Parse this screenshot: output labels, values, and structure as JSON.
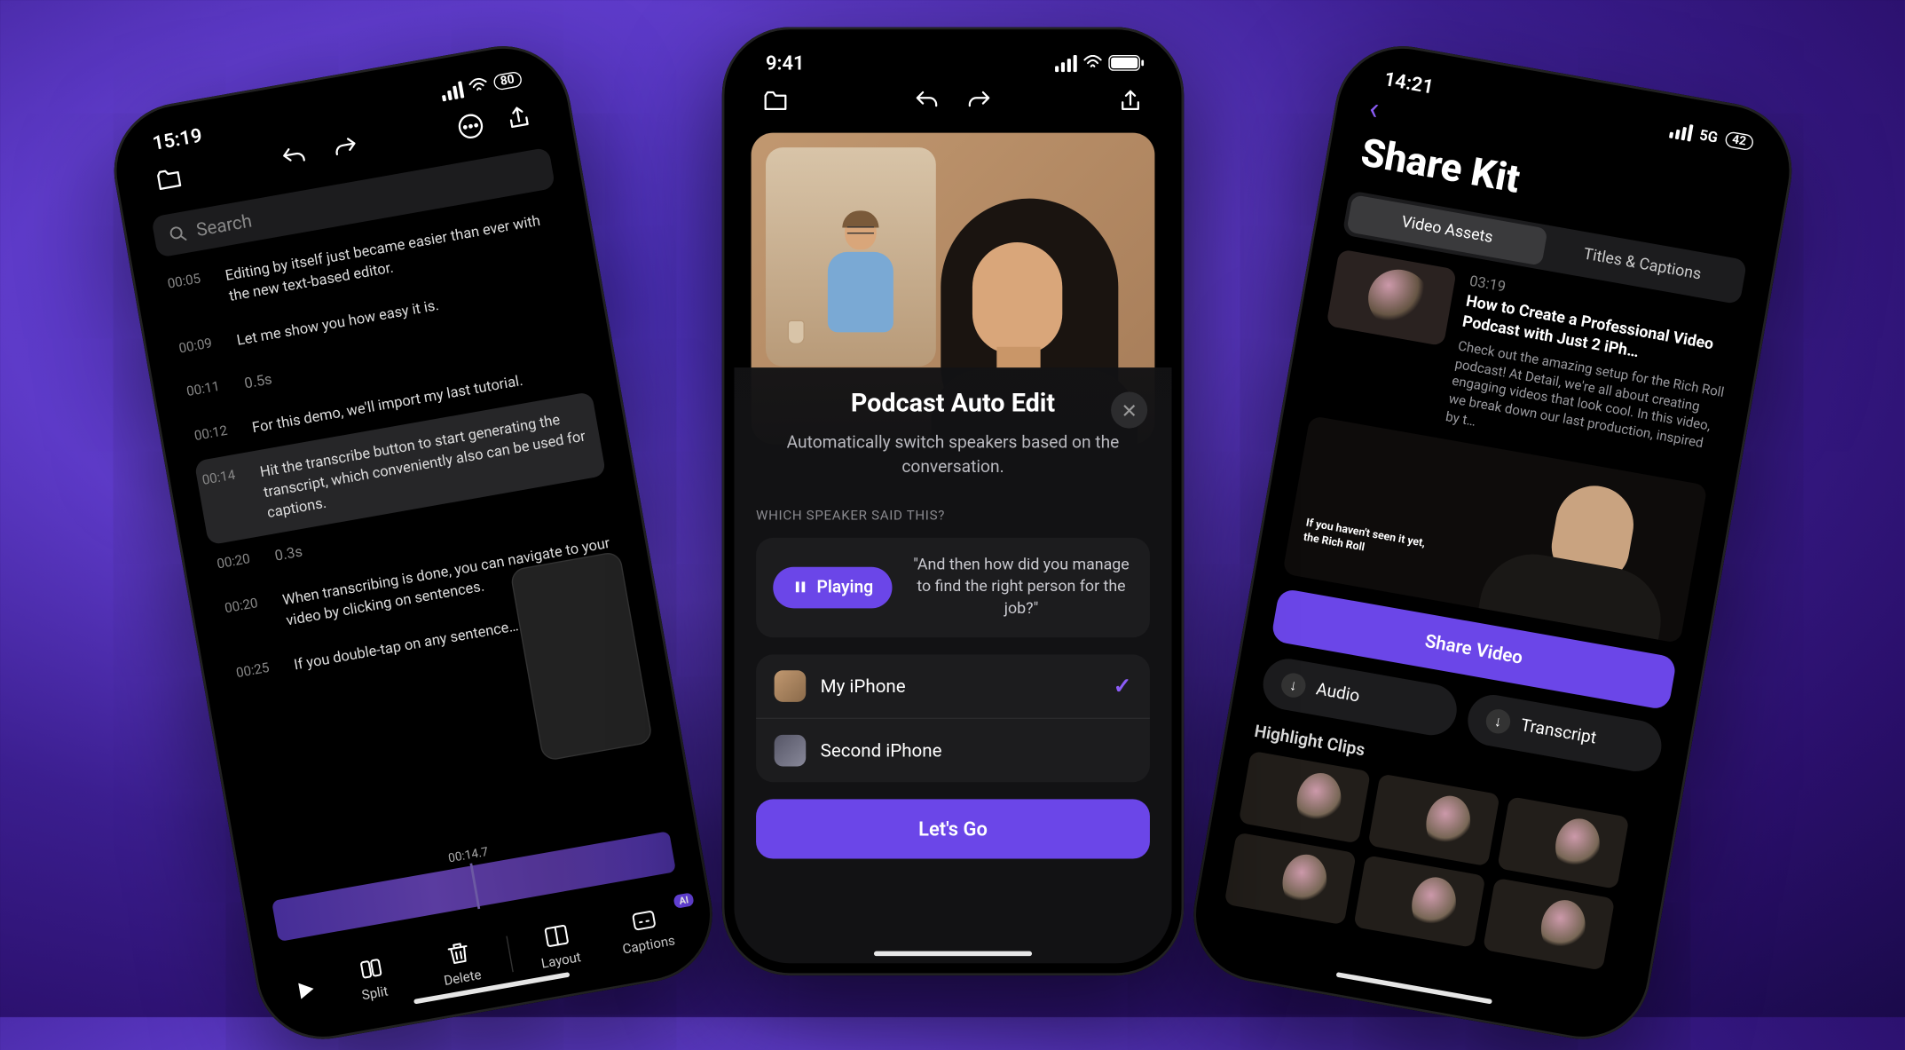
{
  "left": {
    "time": "15:19",
    "battery": "80",
    "search_placeholder": "Search",
    "rows": [
      {
        "ts": "00:05",
        "text": "Editing by itself just became easier than ever with the new text-based editor."
      },
      {
        "ts": "00:09",
        "text": "Let me show you how easy it is."
      },
      {
        "ts": "00:11",
        "text": "0.5s",
        "gap": true
      },
      {
        "ts": "00:12",
        "text": "For this demo, we'll import my last tutorial."
      },
      {
        "ts": "00:14",
        "text": "Hit the transcribe button to start generating the transcript, which conveniently also can be used for captions.",
        "hl": true
      },
      {
        "ts": "00:20",
        "text": "0.3s",
        "gap": true
      },
      {
        "ts": "00:20",
        "text": "When transcribing is done, you can navigate to your video by clicking on sentences."
      },
      {
        "ts": "00:25",
        "text": "If you double-tap on any sentence…"
      }
    ],
    "timeline_time": "00:14.7",
    "tools": {
      "split": "Split",
      "delete": "Delete",
      "layout": "Layout",
      "captions": "Captions"
    }
  },
  "center": {
    "time": "9:41",
    "sheet_title": "Podcast Auto Edit",
    "sheet_desc": "Automatically switch speakers based on the conversation.",
    "label": "WHICH SPEAKER SAID THIS?",
    "playing": "Playing",
    "quote": "\"And then how did you manage to find the right person for the job?\"",
    "speakers": [
      {
        "name": "My iPhone",
        "selected": true
      },
      {
        "name": "Second iPhone",
        "selected": false
      }
    ],
    "cta": "Let's Go"
  },
  "right": {
    "time": "14:21",
    "network": "5G",
    "battery": "42",
    "title": "Share Kit",
    "tabs": [
      "Video Assets",
      "Titles & Captions"
    ],
    "asset": {
      "duration": "03:19",
      "title": "How to Create a Professional Video Podcast with Just 2 iPh…",
      "desc": "Check out the amazing setup for the Rich Roll podcast! At Detail, we're all about creating engaging videos that look cool. In this video, we break down our last production, inspired by t…"
    },
    "caption_overlay": "If you haven't seen it yet, the Rich Roll",
    "share": "Share Video",
    "pills": {
      "audio": "Audio",
      "transcript": "Transcript"
    },
    "clips_label": "Highlight Clips"
  }
}
